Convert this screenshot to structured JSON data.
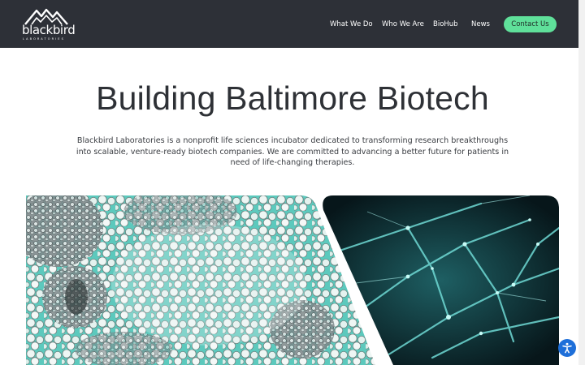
{
  "brand": {
    "name": "blackbird",
    "subline": "LABORATORIES"
  },
  "nav": {
    "items": [
      {
        "label": "What We Do"
      },
      {
        "label": "Who We Are"
      },
      {
        "label": "BioHub"
      },
      {
        "label": "News"
      }
    ],
    "contact_label": "Contact Us"
  },
  "hero": {
    "title": "Building Baltimore Biotech",
    "intro": "Blackbird Laboratories is a nonprofit life sciences incubator dedicated to transforming research breakthroughs into scalable, venture-ready biotech companies. We are committed to advancing a better future for patients in need of life-changing therapies."
  },
  "colors": {
    "header_bg": "#2d3037",
    "accent": "#5fe09a",
    "title": "#2e3136",
    "teal": "#4fc9bd",
    "a11y": "#1e6fd9"
  },
  "icons": {
    "logo": "mountain-logo-icon",
    "accessibility": "accessibility-icon"
  }
}
